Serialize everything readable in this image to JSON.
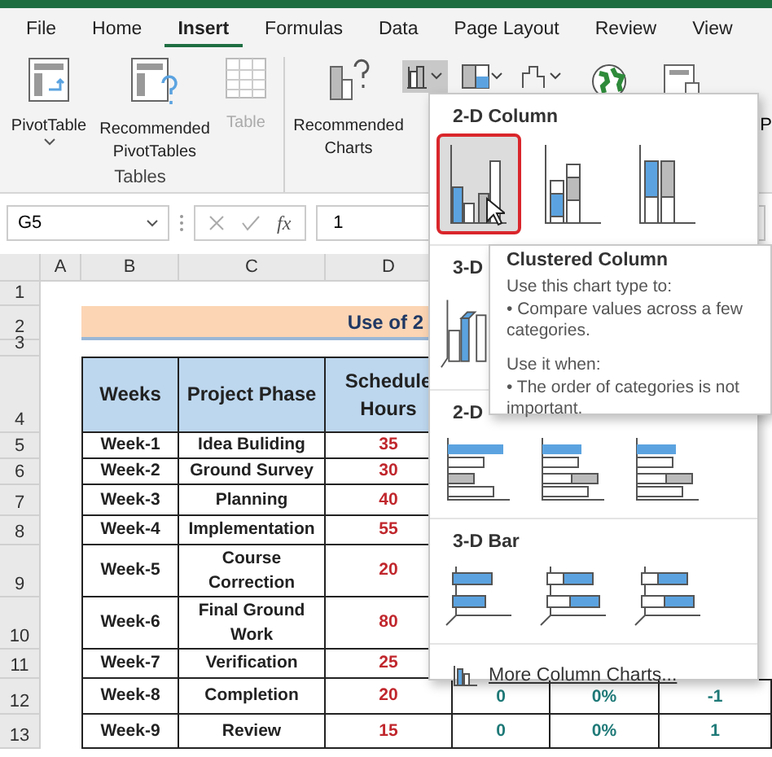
{
  "tabs": [
    {
      "label": "File",
      "selected": false
    },
    {
      "label": "Home",
      "selected": false
    },
    {
      "label": "Insert",
      "selected": true
    },
    {
      "label": "Formulas",
      "selected": false
    },
    {
      "label": "Data",
      "selected": false
    },
    {
      "label": "Page Layout",
      "selected": false
    },
    {
      "label": "Review",
      "selected": false
    },
    {
      "label": "View",
      "selected": false
    }
  ],
  "ribbon": {
    "tables_group": {
      "label": "Tables",
      "commands": [
        {
          "label": "PivotTable",
          "disabled": false,
          "dropdown": true,
          "kind": "pivot"
        },
        {
          "label": "Recommended PivotTables",
          "disabled": false,
          "dropdown": false,
          "kind": "recommended_pivot"
        },
        {
          "label": "Table",
          "disabled": true,
          "dropdown": false,
          "kind": "table"
        }
      ]
    },
    "recommended_charts": "Recommended Charts",
    "cut_label": "P"
  },
  "formula_bar": {
    "name_box": "G5",
    "function_label": "fx",
    "value": "1"
  },
  "sheet": {
    "columns": [
      "A",
      "B",
      "C",
      "D"
    ],
    "row_numbers": [
      "1",
      "2",
      "3",
      "4",
      "5",
      "6",
      "7",
      "8",
      "9",
      "10",
      "11",
      "12",
      "13"
    ],
    "title": "Use of 2",
    "headers": [
      "Weeks",
      "Project Phase",
      "Schedule Hours"
    ],
    "rows": [
      {
        "week": "Week-1",
        "phase": "Idea Buliding",
        "hours": "35",
        "extra": []
      },
      {
        "week": "Week-2",
        "phase": "Ground Survey",
        "hours": "30",
        "extra": []
      },
      {
        "week": "Week-3",
        "phase": "Planning",
        "hours": "40",
        "extra": []
      },
      {
        "week": "Week-4",
        "phase": "Implementation",
        "hours": "55",
        "extra": []
      },
      {
        "week": "Week-5",
        "phase": "Course Correction",
        "hours": "20",
        "extra": []
      },
      {
        "week": "Week-6",
        "phase": "Final Ground Work",
        "hours": "80",
        "extra": []
      },
      {
        "week": "Week-7",
        "phase": "Verification",
        "hours": "25",
        "extra": []
      },
      {
        "week": "Week-8",
        "phase": "Completion",
        "hours": "20",
        "extra": [
          "0",
          "0%",
          "-1"
        ]
      },
      {
        "week": "Week-9",
        "phase": "Review",
        "hours": "15",
        "extra": [
          "0",
          "0%",
          "1"
        ]
      }
    ]
  },
  "chart_menu": {
    "sections": [
      {
        "title": "2-D Column",
        "kind": "column2d",
        "options": [
          {
            "selected": true
          },
          {
            "selected": false
          },
          {
            "selected": false
          }
        ]
      },
      {
        "title": "3-D",
        "kind": "column3d",
        "options": [
          {
            "selected": false
          }
        ]
      },
      {
        "title": "2-D",
        "kind": "bar2d",
        "options": [
          {
            "selected": false
          },
          {
            "selected": false
          },
          {
            "selected": false
          }
        ]
      },
      {
        "title": "3-D Bar",
        "kind": "bar3d",
        "options": [
          {
            "selected": false
          },
          {
            "selected": false
          },
          {
            "selected": false
          }
        ]
      }
    ],
    "more_link": "More Column Charts..."
  },
  "tooltip": {
    "title": "Clustered Column",
    "paragraphs": [
      "Use this chart type to:",
      "• Compare values across a few categories.",
      "Use it when:",
      "• The order of categories is not important."
    ]
  }
}
